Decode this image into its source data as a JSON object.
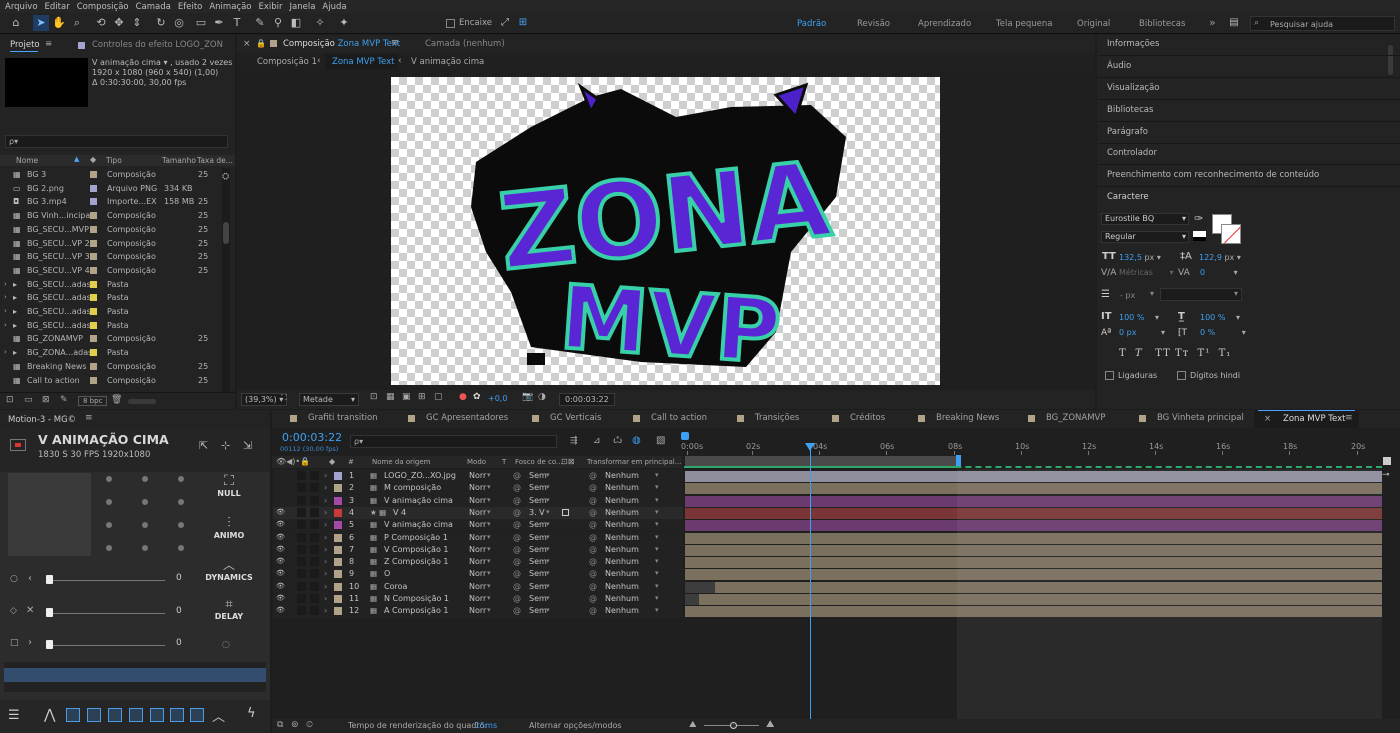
{
  "menu": [
    "Arquivo",
    "Editar",
    "Composição",
    "Camada",
    "Efeito",
    "Animação",
    "Exibir",
    "Janela",
    "Ajuda"
  ],
  "toolbar": {
    "snap_label": "Encaixe",
    "workspaces": [
      "Padrão",
      "Revisão",
      "Aprendizado",
      "Tela pequena",
      "Original",
      "Bibliotecas"
    ],
    "more": "»",
    "search_placeholder": "Pesquisar ajuda"
  },
  "project": {
    "tab_project": "Projeto",
    "tab_effects": "Controles do efeito LOGO_ZON",
    "info_name": "V animação cima",
    "info_used": ", usado 2 vezes",
    "info_res": "1920 x 1080  (960 x 540) (1,00)",
    "info_dur": "Δ 0:30:30:00, 30,00 fps",
    "search_placeholder": "ρ▾",
    "cols": {
      "name": "Nome",
      "type": "Tipo",
      "size": "Tamanho",
      "rate": "Taxa de..."
    },
    "items": [
      {
        "name": "BG 3",
        "type": "Composição",
        "size": "",
        "rate": "25",
        "color": "#b3a28a"
      },
      {
        "name": "BG 2.png",
        "type": "Arquivo PNG",
        "size": "334 KB",
        "rate": "",
        "color": "#a3a3cf"
      },
      {
        "name": "BG 3.mp4",
        "type": "Importe...EX",
        "size": "158 MB",
        "rate": "25",
        "color": "#a3a3cf"
      },
      {
        "name": "BG Vinh...incipal",
        "type": "Composição",
        "size": "",
        "rate": "25",
        "color": "#b3a28a"
      },
      {
        "name": "BG_SECU...MVP",
        "type": "Composição",
        "size": "",
        "rate": "25",
        "color": "#b3a28a"
      },
      {
        "name": "BG_SECU...VP 2",
        "type": "Composição",
        "size": "",
        "rate": "25",
        "color": "#b3a28a"
      },
      {
        "name": "BG_SECU...VP 3",
        "type": "Composição",
        "size": "",
        "rate": "25",
        "color": "#b3a28a"
      },
      {
        "name": "BG_SECU...VP 4",
        "type": "Composição",
        "size": "",
        "rate": "25",
        "color": "#b3a28a"
      },
      {
        "name": "BG_SECU...adas",
        "type": "Pasta",
        "size": "",
        "rate": "",
        "color": "#e0cf4a"
      },
      {
        "name": "BG_SECU...adas",
        "type": "Pasta",
        "size": "",
        "rate": "",
        "color": "#e0cf4a"
      },
      {
        "name": "BG_SECU...adas",
        "type": "Pasta",
        "size": "",
        "rate": "",
        "color": "#e0cf4a"
      },
      {
        "name": "BG_SECU...adas",
        "type": "Pasta",
        "size": "",
        "rate": "",
        "color": "#e0cf4a"
      },
      {
        "name": "BG_ZONAMVP",
        "type": "Composição",
        "size": "",
        "rate": "25",
        "color": "#b3a28a"
      },
      {
        "name": "BG_ZONA...adas",
        "type": "Pasta",
        "size": "",
        "rate": "",
        "color": "#e0cf4a"
      },
      {
        "name": "Breaking News",
        "type": "Composição",
        "size": "",
        "rate": "25",
        "color": "#b3a28a"
      },
      {
        "name": "Call to action",
        "type": "Composição",
        "size": "",
        "rate": "25",
        "color": "#b3a28a"
      }
    ],
    "bpc": "8 bpc"
  },
  "comp": {
    "tab_label": "Composição",
    "tab_name": "Zona MVP Text",
    "layer_tab": "Camada (nenhum)",
    "crumbs": [
      "Composição 1",
      "Zona MVP Text",
      "V animação cima"
    ],
    "zoom": "(39,3%)",
    "resolution": "Metade",
    "exposure": "+0,0",
    "timecode": "0:00:03:22",
    "art_line1": "ZONA",
    "art_line2": "MVP"
  },
  "right": {
    "items": [
      "Informações",
      "Áudio",
      "Visualização",
      "Bibliotecas",
      "Parágrafo",
      "Controlador",
      "Preenchimento com reconhecimento de conteúdo"
    ],
    "char_title": "Caractere",
    "font": "Eurostile BQ",
    "style": "Regular",
    "size_val": "132,5",
    "size_unit": "px",
    "leading_val": "122,9",
    "leading_unit": "px",
    "kerning": "Métricas",
    "tracking": "0",
    "stroke_w": "- px",
    "vscale": "100 %",
    "hscale": "100 %",
    "baseline": "0 px",
    "tsume": "0 %",
    "ligatures": "Ligaduras",
    "hindi": "Dígitos hindi"
  },
  "motion": {
    "title": "Motion-3 - MG©",
    "comp_name": "V ANIMAÇÃO CIMA",
    "comp_info": "1830 S  30 FPS  1920x1080",
    "null": "NULL",
    "animo": "ANIMO",
    "dynamics": "DYNAMICS",
    "delay": "DELAY",
    "slider1": "0",
    "slider2": "0",
    "slider3": "0"
  },
  "timeline": {
    "tabs": [
      "Grafiti transition",
      "GC Apresentadores",
      "GC Verticais",
      "Call to action",
      "Transições",
      "Créditos",
      "Breaking News",
      "BG_ZONAMVP",
      "BG Vinheta principal",
      "Zona MVP Text"
    ],
    "timecode": "0:00:03:22",
    "frames": "00112 (30,00 fps)",
    "cols": {
      "num": "#",
      "name": "Nome da origem",
      "mode": "Modo",
      "t": "T",
      "focus": "Fosco de co...",
      "parent": "Transformar em principal..."
    },
    "ticks": [
      "0:00s",
      "02s",
      "04s",
      "06s",
      "08s",
      "10s",
      "12s",
      "14s",
      "16s",
      "18s",
      "20s"
    ],
    "layers": [
      {
        "n": "1",
        "name": "LOGO_ZO...XO.jpg",
        "mode": "Norr",
        "focus": "Sem",
        "parent": "Nenhum",
        "color": "#a3a3cf",
        "bar": "#8e8e9c"
      },
      {
        "n": "2",
        "name": "M composição",
        "mode": "Norr",
        "focus": "Sem",
        "parent": "Nenhum",
        "color": "#b3a28a",
        "bar": "#7b6f5e"
      },
      {
        "n": "3",
        "name": "V animação cima",
        "mode": "Norr",
        "focus": "Sem",
        "parent": "Nenhum",
        "color": "#a34aa8",
        "bar": "#6b3a6e"
      },
      {
        "n": "4",
        "name": "V 4",
        "mode": "Norr",
        "focus": "3. V",
        "parent": "Nenhum",
        "color": "#c83a3a",
        "bar": "#7a3636"
      },
      {
        "n": "5",
        "name": "V animação cima",
        "mode": "Norr",
        "focus": "Sem",
        "parent": "Nenhum",
        "color": "#a34aa8",
        "bar": "#6b3a6e"
      },
      {
        "n": "6",
        "name": "P Composição 1",
        "mode": "Norr",
        "focus": "Sem",
        "parent": "Nenhum",
        "color": "#b3a28a",
        "bar": "#7b6f5e"
      },
      {
        "n": "7",
        "name": "V Composição 1",
        "mode": "Norr",
        "focus": "Sem",
        "parent": "Nenhum",
        "color": "#b3a28a",
        "bar": "#7b6f5e"
      },
      {
        "n": "8",
        "name": "Z Composição 1",
        "mode": "Norr",
        "focus": "Sem",
        "parent": "Nenhum",
        "color": "#b3a28a",
        "bar": "#7b6f5e"
      },
      {
        "n": "9",
        "name": "O",
        "mode": "Norr",
        "focus": "Sem",
        "parent": "Nenhum",
        "color": "#b3a28a",
        "bar": "#7b6f5e"
      },
      {
        "n": "10",
        "name": "Coroa",
        "mode": "Norr",
        "focus": "Sem",
        "parent": "Nenhum",
        "color": "#b3a28a",
        "bar": "#7b6f5e"
      },
      {
        "n": "11",
        "name": "N Composição 1",
        "mode": "Norr",
        "focus": "Sem",
        "parent": "Nenhum",
        "color": "#b3a28a",
        "bar": "#7b6f5e"
      },
      {
        "n": "12",
        "name": "A Composição 1",
        "mode": "Norr",
        "focus": "Sem",
        "parent": "Nenhum",
        "color": "#b3a28a",
        "bar": "#7b6f5e"
      }
    ],
    "render_label": "Tempo de renderização do quadro:",
    "render_val": "15ms",
    "toggle": "Alternar opções/modos"
  }
}
